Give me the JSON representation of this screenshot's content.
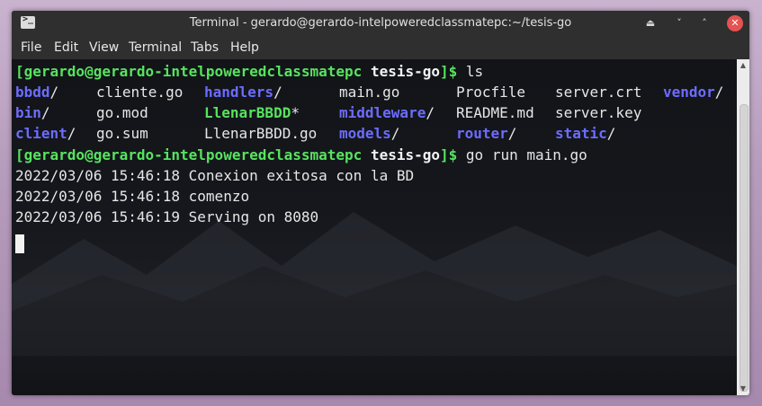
{
  "window": {
    "title": "Terminal - gerardo@gerardo-intelpoweredclassmatepc:~/tesis-go",
    "app_icon_glyph": ">_",
    "controls": {
      "keep_above": "⏏",
      "minimize": "˅",
      "maximize": "˄",
      "close": "✕"
    }
  },
  "menu": [
    "File",
    "Edit",
    "View",
    "Terminal",
    "Tabs",
    "Help"
  ],
  "terminal": {
    "prompt1": {
      "user": "[gerardo@gerardo-intelpoweredclassmatepc",
      "dir": "tesis-go",
      "end": "]$",
      "cmd": " ls"
    },
    "ls_rows": [
      [
        {
          "text": "bbdd",
          "type": "dir",
          "suffix": "/"
        },
        {
          "text": "cliente.go",
          "type": "file",
          "suffix": ""
        },
        {
          "text": "handlers",
          "type": "dir",
          "suffix": "/"
        },
        {
          "text": "main.go",
          "type": "file",
          "suffix": ""
        },
        {
          "text": "Procfile",
          "type": "file",
          "suffix": ""
        },
        {
          "text": "server.crt",
          "type": "file",
          "suffix": ""
        },
        {
          "text": "vendor",
          "type": "dir",
          "suffix": "/"
        }
      ],
      [
        {
          "text": "bin",
          "type": "dir",
          "suffix": "/"
        },
        {
          "text": "go.mod",
          "type": "file",
          "suffix": ""
        },
        {
          "text": "LlenarBBDD",
          "type": "exec",
          "suffix": "*"
        },
        {
          "text": "middleware",
          "type": "dir",
          "suffix": "/"
        },
        {
          "text": "README.md",
          "type": "file",
          "suffix": ""
        },
        {
          "text": "server.key",
          "type": "file",
          "suffix": ""
        },
        {
          "text": "",
          "type": "file",
          "suffix": ""
        }
      ],
      [
        {
          "text": "client",
          "type": "dir",
          "suffix": "/"
        },
        {
          "text": "go.sum",
          "type": "file",
          "suffix": ""
        },
        {
          "text": "LlenarBBDD.go",
          "type": "file",
          "suffix": ""
        },
        {
          "text": "models",
          "type": "dir",
          "suffix": "/"
        },
        {
          "text": "router",
          "type": "dir",
          "suffix": "/"
        },
        {
          "text": "static",
          "type": "dir",
          "suffix": "/"
        },
        {
          "text": "",
          "type": "file",
          "suffix": ""
        }
      ]
    ],
    "prompt2": {
      "user": "[gerardo@gerardo-intelpoweredclassmatepc",
      "dir": "tesis-go",
      "end": "]$",
      "cmd": " go run main.go"
    },
    "output": [
      "2022/03/06 15:46:18 Conexion exitosa con la BD",
      "2022/03/06 15:46:18 comenzo",
      "2022/03/06 15:46:19 Serving on 8080"
    ]
  },
  "colors": {
    "prompt_green": "#57e35f",
    "dir_blue": "#6c6cff",
    "exec_green": "#57e35f",
    "text": "#e6e6e6"
  }
}
